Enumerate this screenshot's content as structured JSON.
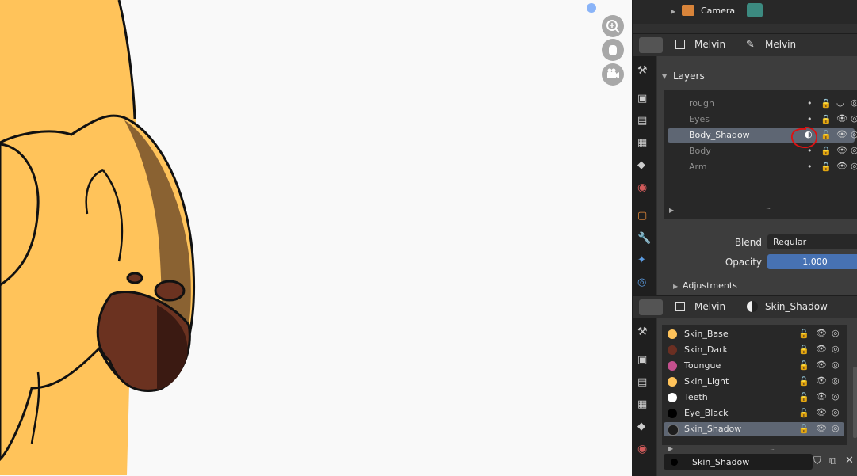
{
  "outliner": {
    "item_label": "Camera"
  },
  "data_header_top": {
    "object_name": "Melvin",
    "data_name": "Melvin"
  },
  "layers_panel": {
    "title": "Layers",
    "layers": [
      {
        "name": "rough",
        "selected": false
      },
      {
        "name": "Eyes",
        "selected": false
      },
      {
        "name": "Body_Shadow",
        "selected": true
      },
      {
        "name": "Body",
        "selected": false
      },
      {
        "name": "Arm",
        "selected": false
      }
    ],
    "blend_label": "Blend",
    "blend_value": "Regular",
    "opacity_label": "Opacity",
    "opacity_value": "1.000",
    "adjustments_label": "Adjustments"
  },
  "material_header": {
    "object_name": "Melvin",
    "material_name": "Skin_Shadow"
  },
  "materials": [
    {
      "name": "Skin_Base",
      "color": "#ffc35a"
    },
    {
      "name": "Skin_Dark",
      "color": "#6b2f22"
    },
    {
      "name": "Toungue",
      "color": "#c4508e"
    },
    {
      "name": "Skin_Light",
      "color": "#ffc35a"
    },
    {
      "name": "Teeth",
      "color": "#ffffff"
    },
    {
      "name": "Eye_Black",
      "color": "#000000"
    },
    {
      "name": "Skin_Shadow",
      "color": "#1e1e1e"
    }
  ],
  "active_material_field": "Skin_Shadow",
  "colors": {
    "accent_blue": "#4772b3",
    "selection": "#5e6673",
    "skin": "#ffc35a",
    "mouth": "#6b2f22"
  },
  "icons": [
    "zoom-icon",
    "hand-pan-icon",
    "camera-view-icon",
    "tool-icon",
    "render-icon",
    "output-icon",
    "view-layer-icon",
    "scene-icon",
    "world-icon",
    "object-icon",
    "modifier-icon",
    "particles-icon",
    "physics-icon",
    "material-icon",
    "lock-icon",
    "eye-icon",
    "onion-icon"
  ]
}
